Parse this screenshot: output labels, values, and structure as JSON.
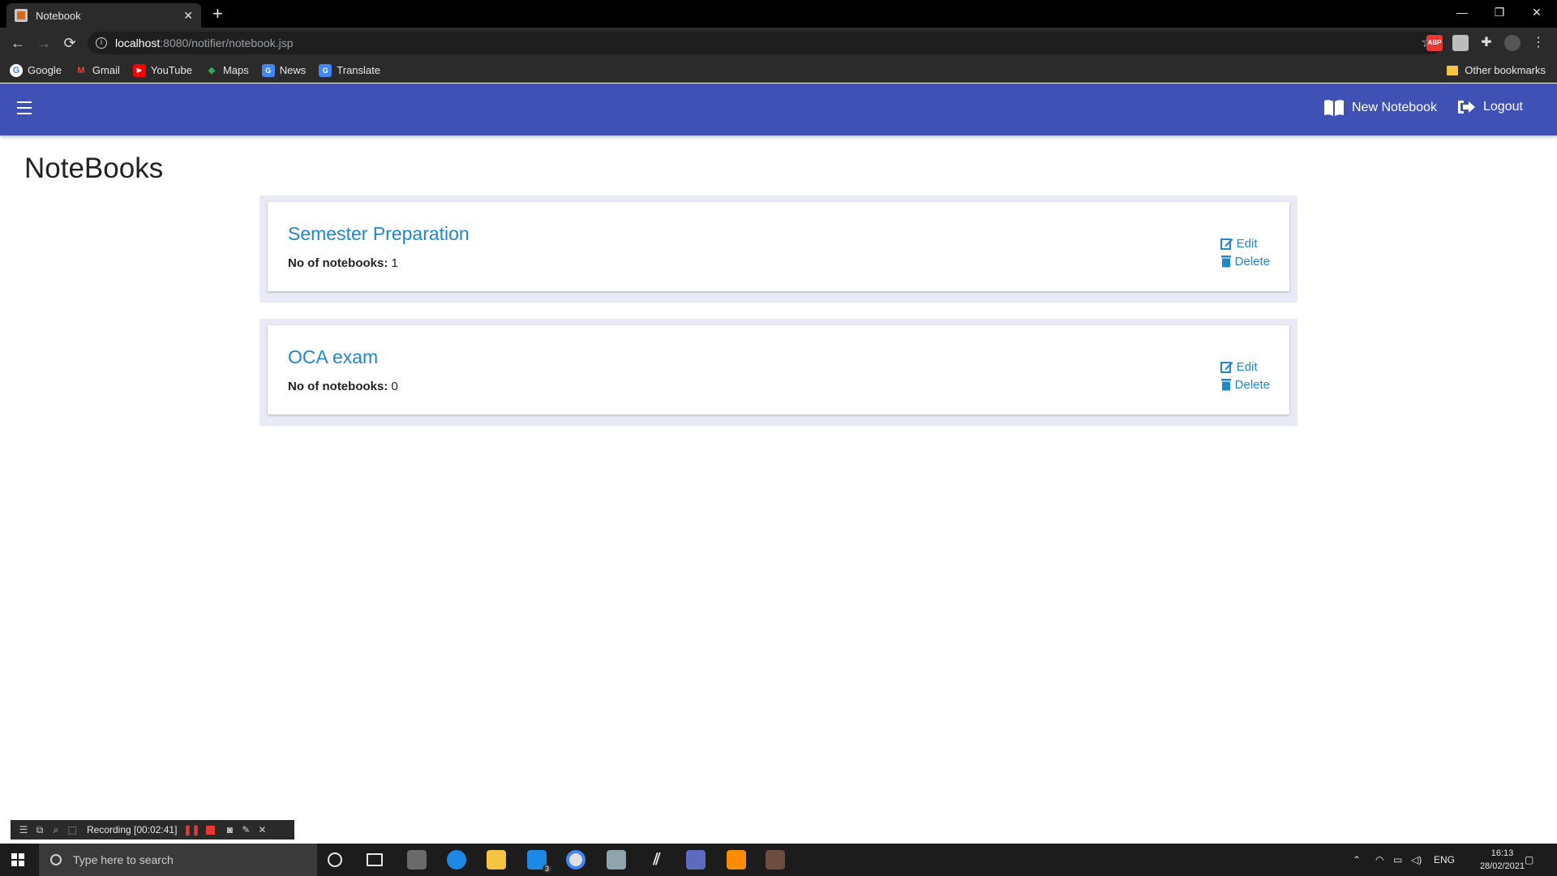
{
  "browser": {
    "tab_title": "Notebook",
    "url_host": "localhost",
    "url_path": ":8080/notifier/notebook.jsp",
    "bookmarks": [
      {
        "label": "Google",
        "icon": "google-icon",
        "color": "#ffffff"
      },
      {
        "label": "Gmail",
        "icon": "gmail-icon",
        "color": "#ea4335"
      },
      {
        "label": "YouTube",
        "icon": "youtube-icon",
        "color": "#ff0000"
      },
      {
        "label": "Maps",
        "icon": "maps-icon",
        "color": "#34a853"
      },
      {
        "label": "News",
        "icon": "news-icon",
        "color": "#4285f4"
      },
      {
        "label": "Translate",
        "icon": "translate-icon",
        "color": "#4285f4"
      }
    ],
    "other_bookmarks": "Other bookmarks"
  },
  "app": {
    "accent": "#3f51b5",
    "link_color": "#1e88c9",
    "new_notebook_label": "New Notebook",
    "logout_label": "Logout",
    "page_title": "NoteBooks",
    "notebooks": [
      {
        "name": "Semester Preparation",
        "count_label": "No of notebooks:",
        "count": "1",
        "edit_label": "Edit",
        "delete_label": "Delete"
      },
      {
        "name": "OCA exam",
        "count_label": "No of notebooks:",
        "count": "0",
        "edit_label": "Edit",
        "delete_label": "Delete"
      }
    ]
  },
  "recorder": {
    "status_text": "Recording [00:02:41]"
  },
  "taskbar": {
    "search_placeholder": "Type here to search",
    "language": "ENG",
    "time": "16:13",
    "date": "28/02/2021",
    "mail_badge": "3"
  }
}
